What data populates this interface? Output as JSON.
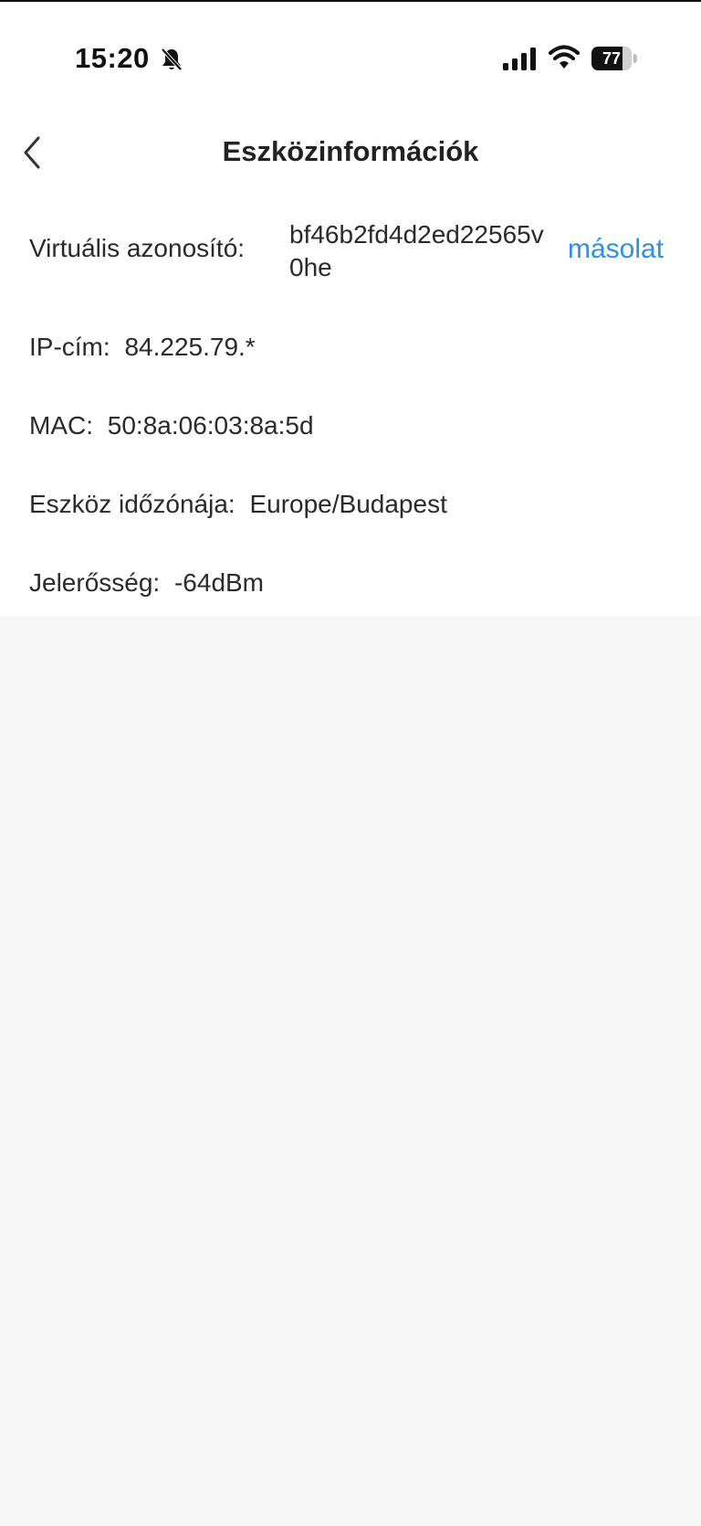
{
  "status_bar": {
    "time": "15:20",
    "battery_level": "77",
    "battery_fraction": 0.77,
    "icons": [
      "bell-slash-icon",
      "signal-icon",
      "wifi-icon",
      "battery-icon"
    ]
  },
  "header": {
    "title": "Eszközinformációk",
    "back_icon": "chevron-left-icon"
  },
  "info": {
    "virtual_id": {
      "label": "Virtuális azonosító:",
      "value": "bf46b2fd4d2ed22565v0he",
      "copy_label": "másolat"
    },
    "ip": {
      "label": "IP-cím:",
      "value": "84.225.79.*"
    },
    "mac": {
      "label": "MAC:",
      "value": "50:8a:06:03:8a:5d"
    },
    "timezone": {
      "label": "Eszköz időzónája:",
      "value": "Europe/Budapest"
    },
    "signal": {
      "label": "Jelerősség:",
      "value": "-64dBm"
    }
  },
  "colors": {
    "accent": "#2f8fe0",
    "text": "#2a2a2a",
    "background": "#f7f7f7",
    "card": "#ffffff"
  }
}
